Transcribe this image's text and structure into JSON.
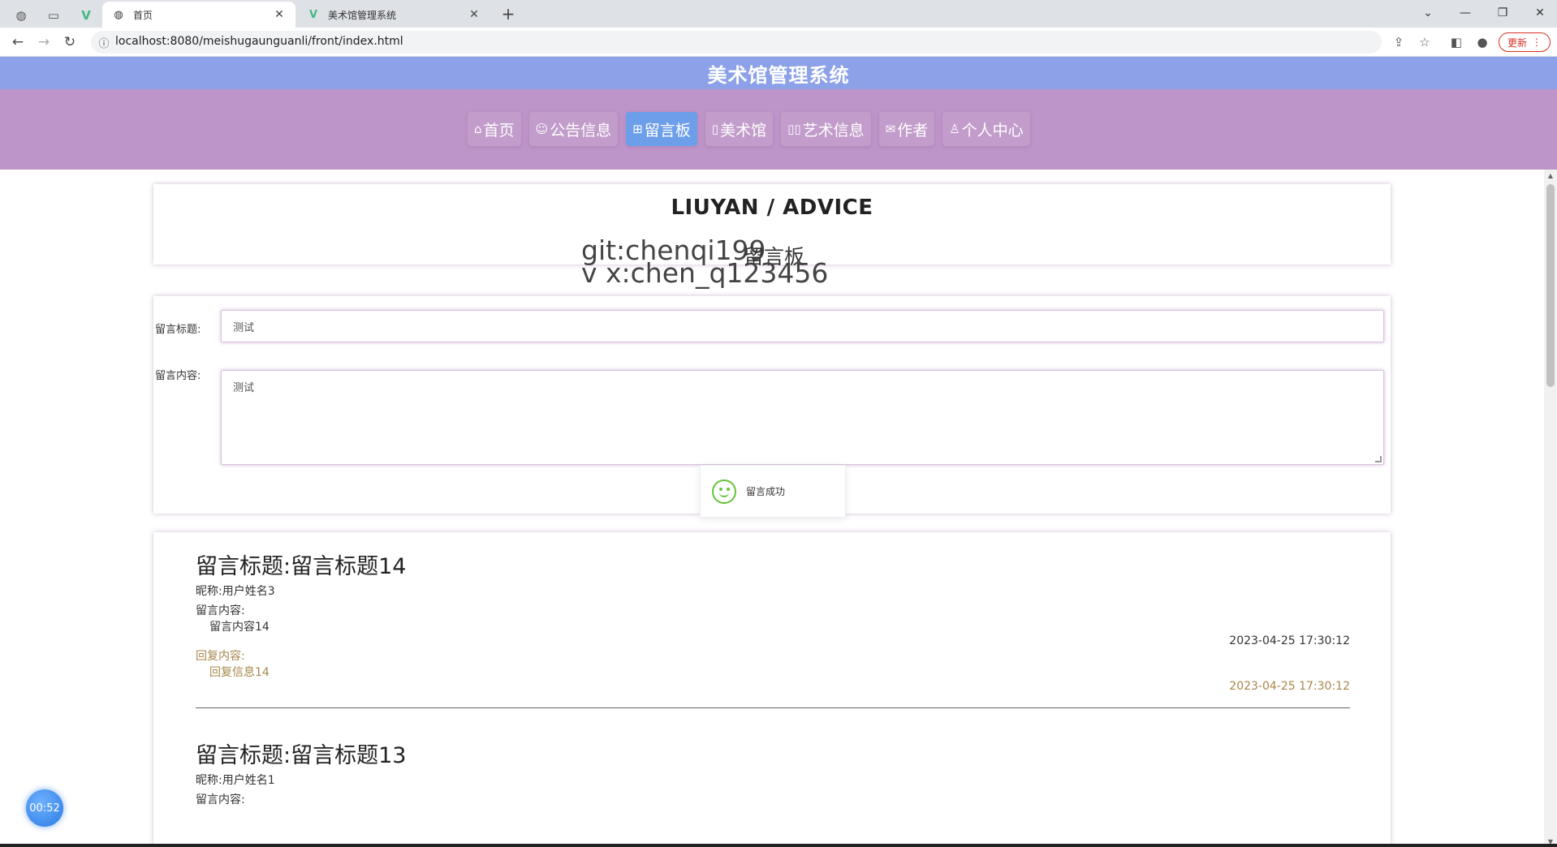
{
  "browser": {
    "tabs": [
      {
        "title": "首页",
        "active": true
      },
      {
        "title": "美术馆管理系统",
        "active": false
      }
    ],
    "url": "localhost:8080/meishugaunguanli/front/index.html",
    "update_label": "更新"
  },
  "site": {
    "title": "美术馆管理系统",
    "nav": [
      {
        "icon": "home-icon",
        "glyph": "⌂",
        "label": "首页"
      },
      {
        "icon": "notice-icon",
        "glyph": "☺",
        "label": "公告信息"
      },
      {
        "icon": "grid-icon",
        "glyph": "⊞",
        "label": "留言板",
        "active": true
      },
      {
        "icon": "museum-icon",
        "glyph": "▯",
        "label": "美术馆"
      },
      {
        "icon": "art-icon",
        "glyph": "▯▯",
        "label": "艺术信息"
      },
      {
        "icon": "mail-icon",
        "glyph": "✉",
        "label": "作者"
      },
      {
        "icon": "user-icon",
        "glyph": "♙",
        "label": "个人中心"
      }
    ]
  },
  "heading": {
    "en": "LIUYAN / ADVICE",
    "watermark_line1": "git:chenqi199",
    "sub": "留言板",
    "watermark_line2": "v x:chen_q123456"
  },
  "form": {
    "title_label": "留言标题:",
    "title_value": "测试",
    "content_label": "留言内容:",
    "content_value": "测试"
  },
  "toast": {
    "message": "留言成功"
  },
  "messages": [
    {
      "title": "留言标题:留言标题14",
      "nickname": "昵称:用户姓名3",
      "content_label": "留言内容:",
      "content": "留言内容14",
      "time": "2023-04-25 17:30:12",
      "reply_label": "回复内容:",
      "reply": "回复信息14",
      "reply_time": "2023-04-25 17:30:12"
    },
    {
      "title": "留言标题:留言标题13",
      "nickname": "昵称:用户姓名1",
      "content_label": "留言内容:"
    }
  ],
  "timer": "00:52"
}
